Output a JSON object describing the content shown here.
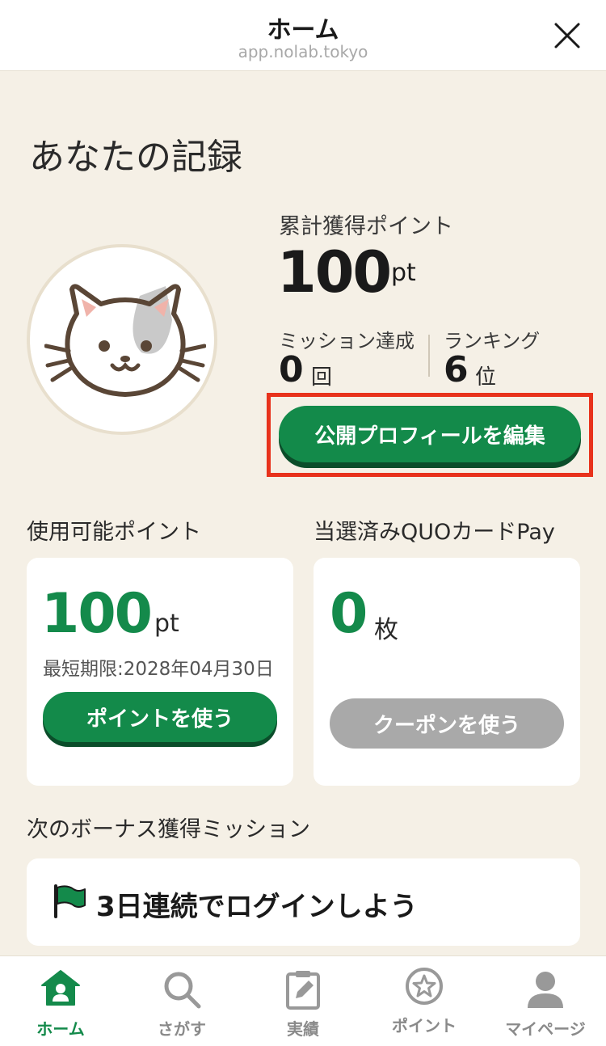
{
  "header": {
    "title": "ホーム",
    "url": "app.nolab.tokyo"
  },
  "record": {
    "title": "あなたの記録",
    "total_points_label": "累計獲得ポイント",
    "total_points_value": "100",
    "total_points_unit": "pt",
    "missions_label": "ミッション達成",
    "missions_value": "0",
    "missions_unit": "回",
    "ranking_label": "ランキング",
    "ranking_value": "6",
    "ranking_unit": "位",
    "edit_profile_label": "公開プロフィールを編集"
  },
  "points_card": {
    "title": "使用可能ポイント",
    "value": "100",
    "unit": "pt",
    "expiry": "最短期限:2028年04月30日",
    "button_label": "ポイントを使う"
  },
  "quo_card": {
    "title": "当選済みQUOカードPay",
    "value": "0",
    "unit": "枚",
    "button_label": "クーポンを使う"
  },
  "mission": {
    "title": "次のボーナス獲得ミッション",
    "item": "3日連続でログインしよう"
  },
  "nav": {
    "items": [
      {
        "label": "ホーム",
        "icon": "home-icon"
      },
      {
        "label": "さがす",
        "icon": "search-icon"
      },
      {
        "label": "実績",
        "icon": "clipboard-icon"
      },
      {
        "label": "ポイント",
        "icon": "star-icon"
      },
      {
        "label": "マイページ",
        "icon": "user-icon"
      }
    ]
  },
  "colors": {
    "accent": "#138a4a",
    "background": "#f5f0e6",
    "highlight": "#e8321c",
    "disabled": "#a9a9a9"
  }
}
